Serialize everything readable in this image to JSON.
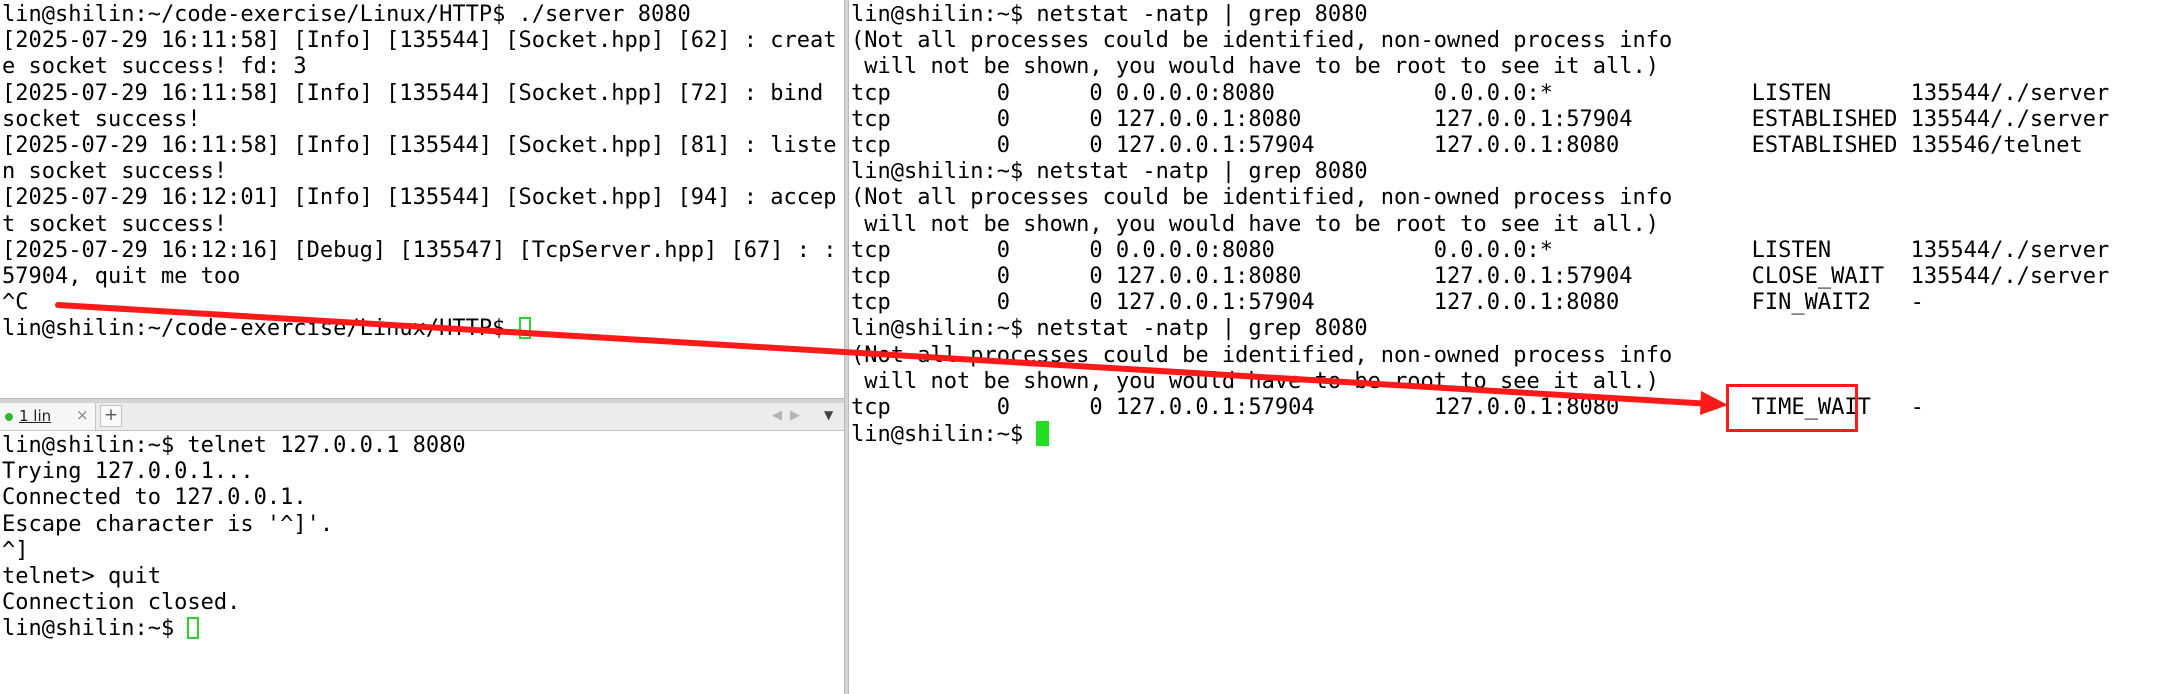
{
  "server_pane": {
    "lines": [
      "lin@shilin:~/code-exercise/Linux/HTTP$ ./server 8080",
      "[2025-07-29 16:11:58] [Info] [135544] [Socket.hpp] [62] : creat",
      "e socket success! fd: 3",
      "[2025-07-29 16:11:58] [Info] [135544] [Socket.hpp] [72] : bind",
      "socket success!",
      "[2025-07-29 16:11:58] [Info] [135544] [Socket.hpp] [81] : liste",
      "n socket success!",
      "[2025-07-29 16:12:01] [Info] [135544] [Socket.hpp] [94] : accep",
      "t socket success!",
      "[2025-07-29 16:12:16] [Debug] [135547] [TcpServer.hpp] [67] : :",
      "57904, quit me too",
      "^C"
    ],
    "prompt": "lin@shilin:~/code-exercise/Linux/HTTP$ "
  },
  "tab_bar": {
    "tab_label": "1 lin",
    "close_glyph": "×",
    "add_glyph": "+",
    "prev_glyph": "◀",
    "next_glyph": "▶",
    "menu_glyph": "▼"
  },
  "client_pane": {
    "lines": [
      "lin@shilin:~$ telnet 127.0.0.1 8080",
      "Trying 127.0.0.1...",
      "Connected to 127.0.0.1.",
      "Escape character is '^]'.",
      "^]",
      "telnet> quit",
      "Connection closed."
    ],
    "prompt": "lin@shilin:~$ "
  },
  "netstat_pane": {
    "lines": [
      "lin@shilin:~$ netstat -natp | grep 8080",
      "(Not all processes could be identified, non-owned process info",
      " will not be shown, you would have to be root to see it all.)",
      "tcp        0      0 0.0.0.0:8080            0.0.0.0:*               LISTEN      135544/./server",
      "tcp        0      0 127.0.0.1:8080          127.0.0.1:57904         ESTABLISHED 135544/./server",
      "tcp        0      0 127.0.0.1:57904         127.0.0.1:8080          ESTABLISHED 135546/telnet",
      "lin@shilin:~$ netstat -natp | grep 8080",
      "(Not all processes could be identified, non-owned process info",
      " will not be shown, you would have to be root to see it all.)",
      "tcp        0      0 0.0.0.0:8080            0.0.0.0:*               LISTEN      135544/./server",
      "tcp        0      0 127.0.0.1:8080          127.0.0.1:57904         CLOSE_WAIT  135544/./server",
      "tcp        0      0 127.0.0.1:57904         127.0.0.1:8080          FIN_WAIT2   -",
      "lin@shilin:~$ netstat -natp | grep 8080",
      "(Not all processes could be identified, non-owned process info",
      " will not be shown, you would have to be root to see it all.)",
      "tcp        0      0 127.0.0.1:57904         127.0.0.1:8080          TIME_WAIT   -"
    ],
    "prompt": "lin@shilin:~$ "
  },
  "annotation": {
    "color": "#ff1a1a",
    "shape": "arrow-and-box"
  },
  "colors": {
    "cursor_green": "#22dd22",
    "background": "#ffffff",
    "text": "#000000"
  }
}
